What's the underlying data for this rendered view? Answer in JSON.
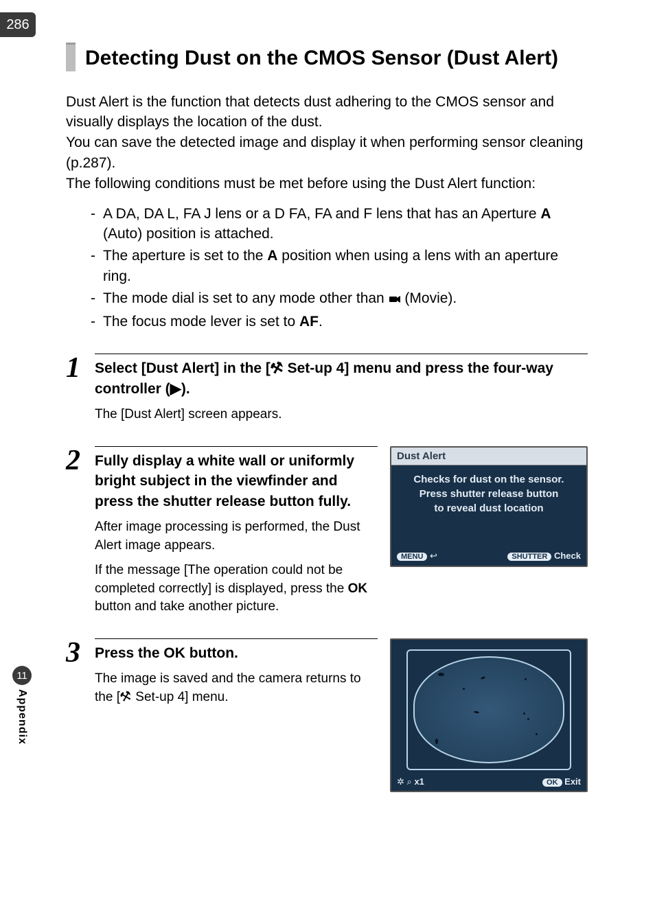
{
  "page_number": "286",
  "side_tab": {
    "number": "11",
    "label": "Appendix"
  },
  "title": "Detecting Dust on the CMOS Sensor (Dust Alert)",
  "intro": [
    "Dust Alert is the function that detects dust adhering to the CMOS sensor and visually displays the location of the dust.",
    "You can save the detected image and display it when performing sensor cleaning (p.287).",
    "The following conditions must be met before using the Dust Alert function:"
  ],
  "bullets": {
    "b1a": "A DA, DA L, FA J lens or a D FA, FA and F lens that has an Aperture ",
    "b1b": " (Auto) position is attached.",
    "b2a": "The aperture is set to the ",
    "b2b": " position when using a lens with an aperture ring.",
    "b3a": "The mode dial is set to any mode other than ",
    "b3b": " (Movie).",
    "b4a": "The focus mode lever is set to ",
    "b4b": ".",
    "sym_A": "A",
    "sym_AF": "AF",
    "sym_movie": "⚙"
  },
  "steps": {
    "s1": {
      "num": "1",
      "title_a": "Select [Dust Alert] in the [",
      "title_b": " Set-up 4] menu and press the four-way controller (",
      "title_c": ").",
      "arrow": "▶",
      "desc": "The [Dust Alert] screen appears."
    },
    "s2": {
      "num": "2",
      "title": "Fully display a white wall or uniformly bright subject in the viewfinder and press the shutter release button fully.",
      "desc1": "After image processing is performed, the Dust Alert image appears.",
      "desc2a": "If the message [The operation could not be completed correctly] is displayed, press the ",
      "desc2b": " button and take another picture.",
      "ok": "OK",
      "lcd": {
        "header": "Dust Alert",
        "body": "Checks for dust on the sensor.\nPress shutter release button\nto reveal dust location",
        "menu": "MENU",
        "back": "↩",
        "shutter": "SHUTTER",
        "check": "Check"
      }
    },
    "s3": {
      "num": "3",
      "title_a": "Press the ",
      "title_b": " button.",
      "ok": "OK",
      "desc_a": "The image is saved and the camera returns to the [",
      "desc_b": " Set-up 4] menu.",
      "footer": {
        "zoom": "x1",
        "mag": "⌕",
        "dial": "✲",
        "ok": "OK",
        "exit": "Exit"
      }
    }
  },
  "icons": {
    "wrench": "⚒"
  }
}
